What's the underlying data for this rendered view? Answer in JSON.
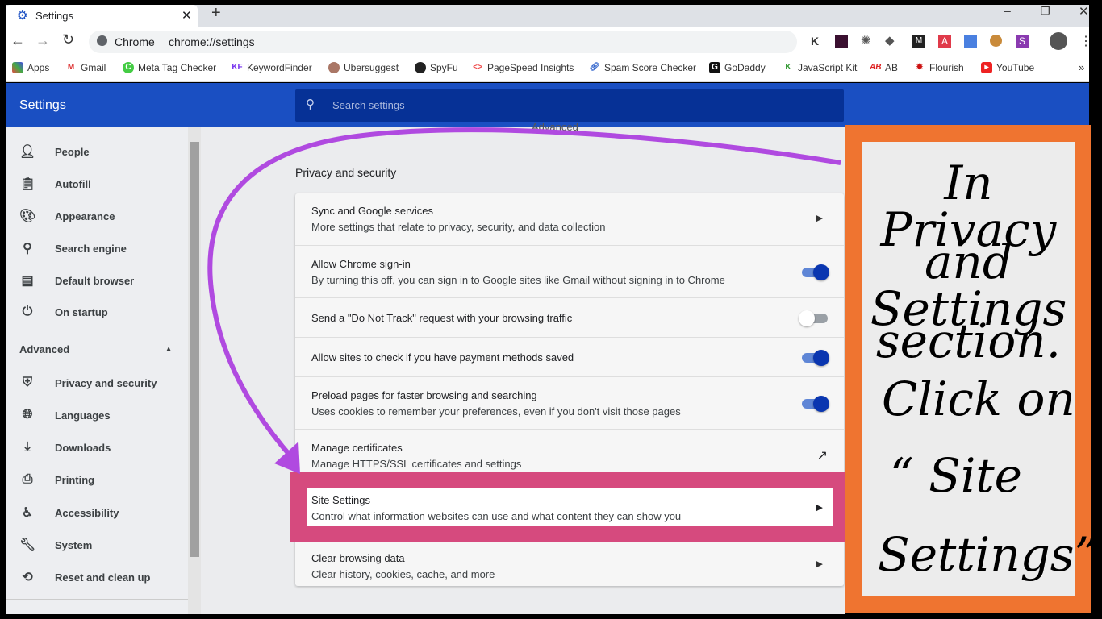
{
  "browser": {
    "tab_title": "Settings",
    "omnibox_site": "Chrome",
    "omnibox_url": "chrome://settings",
    "bookmarks": [
      "Apps",
      "Gmail",
      "Meta Tag Checker",
      "KeywordFinder",
      "Ubersuggest",
      "SpyFu",
      "PageSpeed Insights",
      "Spam Score Checker",
      "GoDaddy",
      "JavaScript Kit",
      "AB",
      "Flourish",
      "YouTube"
    ],
    "extensions": [
      "K",
      "M",
      "A",
      "S"
    ]
  },
  "header": {
    "title": "Settings",
    "search_placeholder": "Search settings"
  },
  "sidebar": {
    "items": [
      "People",
      "Autofill",
      "Appearance",
      "Search engine",
      "Default browser",
      "On startup"
    ],
    "advanced_label": "Advanced",
    "advanced_items": [
      "Privacy and security",
      "Languages",
      "Downloads",
      "Printing",
      "Accessibility",
      "System",
      "Reset and clean up"
    ]
  },
  "main": {
    "clipped_heading": "Advanced",
    "section_title": "Privacy and security",
    "rows": [
      {
        "title": "Sync and Google services",
        "subtitle": "More settings that relate to privacy, security, and data collection",
        "control": "arrow"
      },
      {
        "title": "Allow Chrome sign-in",
        "subtitle": "By turning this off, you can sign in to Google sites like Gmail without signing in to Chrome",
        "control": "toggle",
        "on": true
      },
      {
        "title": "Send a \"Do Not Track\" request with your browsing traffic",
        "control": "toggle",
        "on": false
      },
      {
        "title": "Allow sites to check if you have payment methods saved",
        "control": "toggle",
        "on": true
      },
      {
        "title": "Preload pages for faster browsing and searching",
        "subtitle": "Uses cookies to remember your preferences, even if you don't visit those pages",
        "control": "toggle",
        "on": true
      },
      {
        "title": "Manage certificates",
        "subtitle": "Manage HTTPS/SSL certificates and settings",
        "control": "external"
      },
      {
        "title": "Site Settings",
        "subtitle": "Control what information websites can use and what content they can show you",
        "control": "arrow"
      },
      {
        "title": "Clear browsing data",
        "subtitle": "Clear history, cookies, cache, and more",
        "control": "arrow"
      }
    ]
  },
  "annotation": {
    "lines": [
      "In Privacy",
      "and Settings",
      "section.",
      "Click on",
      "“ Site",
      "Settings”"
    ],
    "highlight_color": "#d64a7e",
    "panel_color": "#ef7430",
    "arrow_color": "#b04ae0"
  }
}
